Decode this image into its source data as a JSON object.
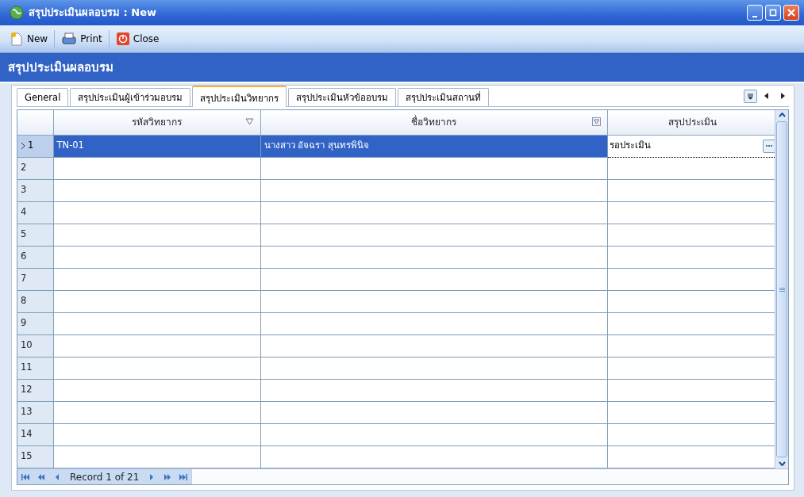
{
  "window": {
    "title": "สรุปประเมินผลอบรม : New"
  },
  "toolbar": [
    {
      "label": "New",
      "kind": "new"
    },
    {
      "label": "Print",
      "kind": "print"
    },
    {
      "label": "Close",
      "kind": "close"
    }
  ],
  "heading": "สรุปประเมินผลอบรม",
  "tabs": [
    {
      "label": "General",
      "selected": false
    },
    {
      "label": "สรุปประเมินผู้เข้าร่วมอบรม",
      "selected": false
    },
    {
      "label": "สรุปประเมินวิทยากร",
      "selected": true
    },
    {
      "label": "สรุปประเมินหัวข้ออบรม",
      "selected": false
    },
    {
      "label": "สรุปประเมินสถานที่",
      "selected": false
    }
  ],
  "grid": {
    "columns": [
      {
        "label": "รหัสวิทยากร",
        "filter_active": false
      },
      {
        "label": "ชื่อวิทยากร",
        "filter_active": true
      },
      {
        "label": "สรุปประเมิน",
        "filter_active": false
      }
    ],
    "rows": [
      {
        "number": "1",
        "selected": true,
        "cells": [
          "TN-01",
          "นางสาว อัจฉรา สุนทรพินิจ",
          "รอประเมิน"
        ]
      },
      {
        "number": "2",
        "selected": false
      },
      {
        "number": "3",
        "selected": false
      },
      {
        "number": "4",
        "selected": false
      },
      {
        "number": "5",
        "selected": false
      },
      {
        "number": "6",
        "selected": false
      },
      {
        "number": "7",
        "selected": false
      },
      {
        "number": "8",
        "selected": false
      },
      {
        "number": "9",
        "selected": false
      },
      {
        "number": "10",
        "selected": false
      },
      {
        "number": "11",
        "selected": false
      },
      {
        "number": "12",
        "selected": false
      },
      {
        "number": "13",
        "selected": false
      },
      {
        "number": "14",
        "selected": false
      },
      {
        "number": "15",
        "selected": false
      }
    ]
  },
  "navigator": {
    "record_text": "Record 1 of 21"
  }
}
